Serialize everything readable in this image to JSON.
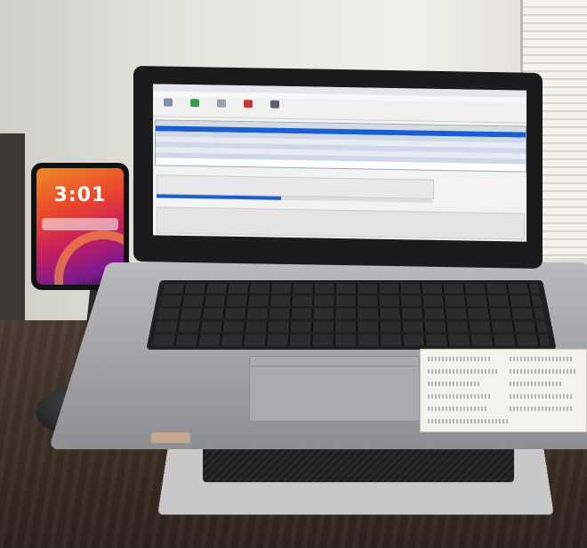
{
  "scene": {
    "description_visible_text": true
  },
  "phone": {
    "clock": "3:01"
  },
  "laptop_app": {
    "window_title": "",
    "toolbar_buttons": [
      "",
      "",
      "",
      "",
      "",
      ""
    ],
    "grid_row_count": 9,
    "progress_fraction": 0.45
  },
  "colors": {
    "wall": "#e6e5df",
    "desk": "#3a2d24",
    "laptop": "#a5a6a9",
    "phone_wallpaper_accent": "#e8452c",
    "app_selection": "#1a5fd0"
  },
  "icons": {
    "phone": "smartphone-icon",
    "laptop": "laptop-icon"
  }
}
